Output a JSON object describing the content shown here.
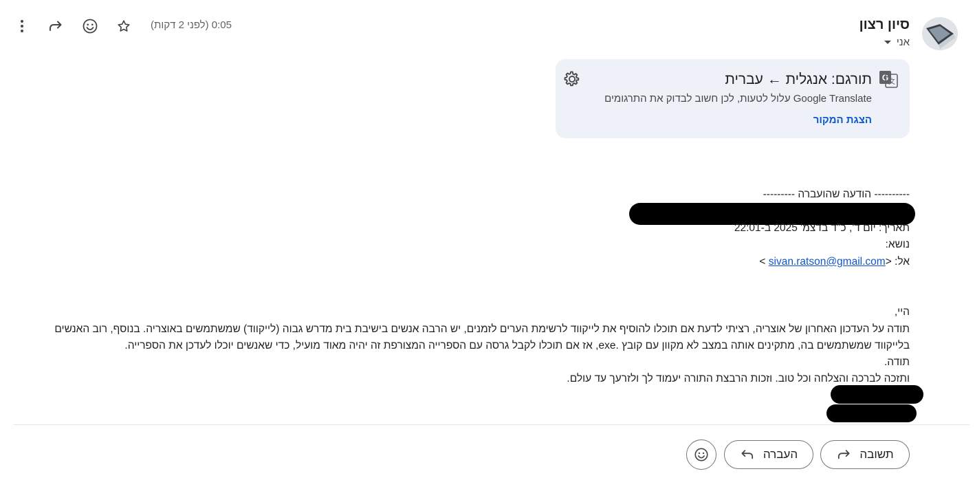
{
  "header": {
    "sender_name": "סיון רצון",
    "recipient_label": "אני",
    "timestamp": "0:05 (לפני 2 דקות)"
  },
  "translate_panel": {
    "title": "תורגם: אנגלית ← עברית",
    "subtitle": "Google Translate עלול לטעות, לכן חשוב לבדוק את התרגומים",
    "show_original": "הצגת המקור"
  },
  "message": {
    "forwarded_header": "---------- הודעה שהועברה ---------",
    "date_line": "תאריך: יום ד', כ\"ד בדצמ' 2025 ב-22:01",
    "subject_line": "נושא:",
    "to_label": "אל: <",
    "to_email": "sivan.ratson@gmail.com",
    "to_close": " >",
    "greeting": "היי,",
    "paragraph": "תודה על העדכון האחרון של אוצריה, רציתי לדעת אם תוכלו להוסיף את לייקווד לרשימת הערים לזמנים, יש הרבה אנשים בישיבת בית מדרש גבוה (לייקווד) שמשתמשים באוצריה. בנוסף, רוב האנשים בלייקווד שמשתמשים בה, מתקינים אותה במצב לא מקוון עם קובץ .exe, אז אם תוכלו לקבל גרסה עם הספרייה המצורפת זה יהיה מאוד מועיל, כדי שאנשים יוכלו לעדכן את הספרייה.",
    "thanks": "תודה.",
    "blessing": "ותזכה לברכה והצלחה וכל טוב. וזכות הרבצת התורה יעמוד לך ולזרעך עד עולם."
  },
  "actions": {
    "reply": "תשובה",
    "forward": "העברה"
  },
  "icons": {
    "more": "more-vert-icon",
    "forward": "forward-arrow-icon",
    "emoji": "emoji-icon",
    "star": "star-icon",
    "translate": "translate-icon",
    "settings": "gear-icon"
  },
  "colors": {
    "link": "#0b57d0",
    "panel_bg": "#eef2f8"
  }
}
